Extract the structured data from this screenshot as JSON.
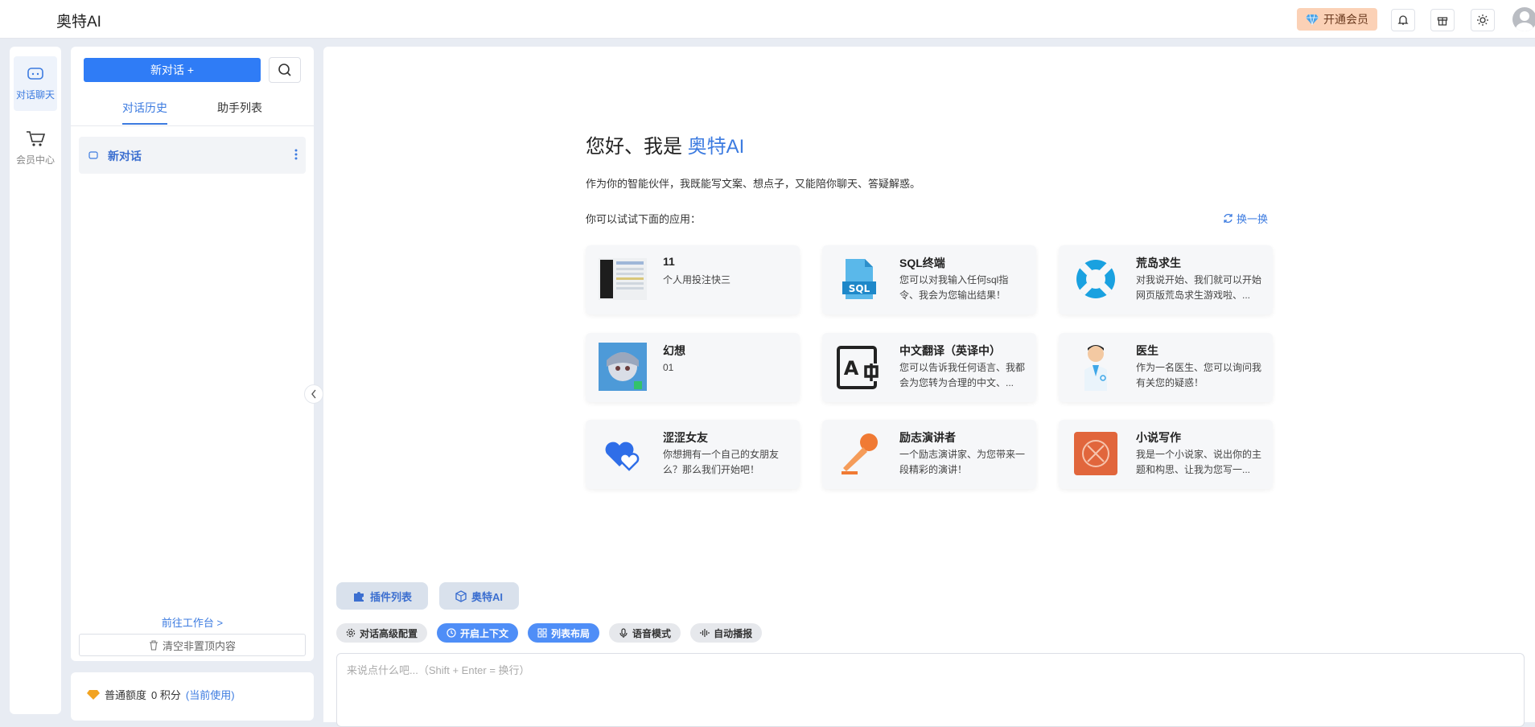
{
  "app": {
    "title": "奥特AI"
  },
  "topbar": {
    "vip_label": "开通会员"
  },
  "rail": {
    "items": [
      {
        "label": "对话聊天",
        "icon": "chat-icon"
      },
      {
        "label": "会员中心",
        "icon": "cart-icon"
      }
    ]
  },
  "sidebar": {
    "new_chat_label": "新对话 +",
    "tabs": [
      {
        "label": "对话历史"
      },
      {
        "label": "助手列表"
      }
    ],
    "history": [
      {
        "label": "新对话"
      }
    ],
    "goto_workspace": "前往工作台 >",
    "clear_label": "清空非置顶内容"
  },
  "quota": {
    "label": "普通额度",
    "amount": "0 积分",
    "current": "(当前使用)"
  },
  "main": {
    "greeting": "您好、我是",
    "brand": "奥特AI",
    "intro": "作为你的智能伙伴，我既能写文案、想点子，又能陪你聊天、答疑解惑。",
    "try_label": "你可以试试下面的应用：",
    "shuffle_label": "换一换",
    "cards": [
      {
        "title": "11",
        "desc": "个人用投注快三"
      },
      {
        "title": "SQL终端",
        "desc": "您可以对我输入任何sql指令、我会为您输出结果！"
      },
      {
        "title": "荒岛求生",
        "desc": "对我说开始、我们就可以开始网页版荒岛求生游戏啦、..."
      },
      {
        "title": "幻想",
        "desc": "01"
      },
      {
        "title": "中文翻译（英译中）",
        "desc": "您可以告诉我任何语言、我都会为您转为合理的中文、..."
      },
      {
        "title": "医生",
        "desc": "作为一名医生、您可以询问我有关您的疑惑！"
      },
      {
        "title": "涩涩女友",
        "desc": "你想拥有一个自己的女朋友么？那么我们开始吧！"
      },
      {
        "title": "励志演讲者",
        "desc": "一个励志演讲家、为您带来一段精彩的演讲！"
      },
      {
        "title": "小说写作",
        "desc": "我是一个小说家、说出你的主题和构思、让我为您写一..."
      }
    ],
    "plugins": [
      {
        "label": "插件列表"
      },
      {
        "label": "奥特AI"
      }
    ],
    "options": [
      {
        "label": "对话高级配置",
        "on": false
      },
      {
        "label": "开启上下文",
        "on": true
      },
      {
        "label": "列表布局",
        "on": true
      },
      {
        "label": "语音模式",
        "on": false
      },
      {
        "label": "自动播报",
        "on": false
      }
    ],
    "input_placeholder": "来说点什么吧...（Shift + Enter = 换行）"
  },
  "colors": {
    "accent": "#3c7be0",
    "primary_button": "#2f7cf6",
    "vip_bg": "#fbd1b6"
  }
}
